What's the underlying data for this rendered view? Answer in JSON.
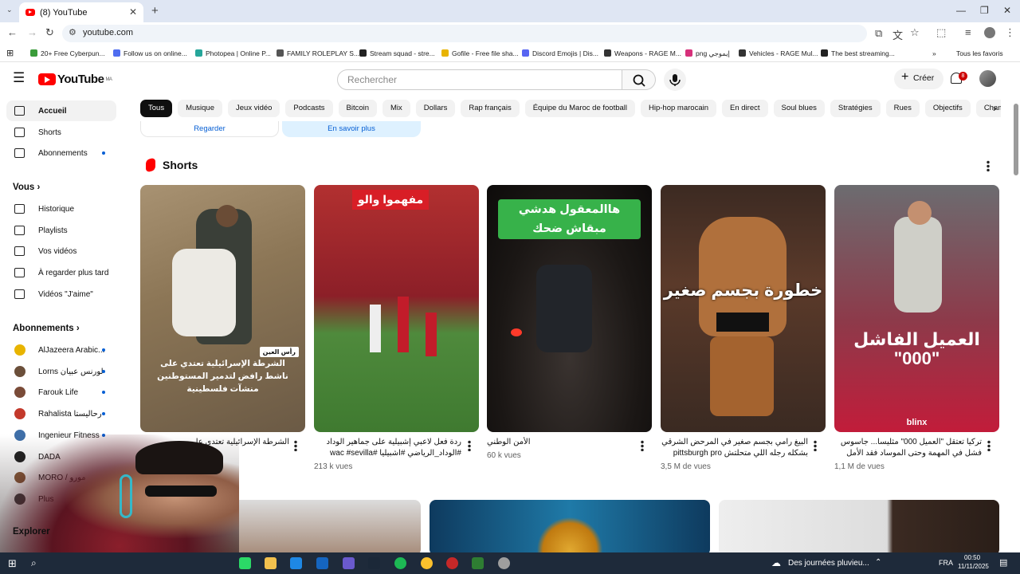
{
  "browser": {
    "tab_title": "(8) YouTube",
    "new_tab": "+",
    "url": "youtube.com",
    "bookmarks": [
      {
        "label": "20+ Free Cyberpun...",
        "color": "#3a9c3a"
      },
      {
        "label": "Follow us on online...",
        "color": "#4f6df0"
      },
      {
        "label": "Photopea | Online P...",
        "color": "#26a69a"
      },
      {
        "label": "FAMILY ROLEPLAY S...",
        "color": "#555555"
      },
      {
        "label": "Stream squad - stre...",
        "color": "#222222"
      },
      {
        "label": "Gofile - Free file sha...",
        "color": "#e8b400"
      },
      {
        "label": "Discord Emojis | Dis...",
        "color": "#5865f2"
      },
      {
        "label": "Weapons - RAGE M...",
        "color": "#333333"
      },
      {
        "label": "png إيموجي",
        "color": "#d6307a"
      },
      {
        "label": "Vehicles - RAGE Mul...",
        "color": "#333333"
      },
      {
        "label": "The best streaming...",
        "color": "#222222"
      }
    ],
    "all_bookmarks": "Tous les favoris"
  },
  "youtube": {
    "logo": "YouTube",
    "region": "MA",
    "search_placeholder": "Rechercher",
    "create": "Créer",
    "notifications": "8",
    "sidebar": {
      "main": [
        "Accueil",
        "Shorts",
        "Abonnements"
      ],
      "you_header": "Vous",
      "you": [
        "Historique",
        "Playlists",
        "Vos vidéos",
        "À regarder plus tard",
        "Vidéos \"J'aime\""
      ],
      "subs_header": "Abonnements",
      "subs": [
        "AlJazeera Arabic...",
        "Lorns لورنس عبيان",
        "Farouk Life",
        "Rahalista رحاليستا",
        "Ingenieur Fitness",
        "DADA",
        "MORO / مورو",
        "Plus"
      ],
      "explore_header": "Explorer"
    },
    "chips": [
      "Tous",
      "Musique",
      "Jeux vidéo",
      "Podcasts",
      "Bitcoin",
      "Mix",
      "Dollars",
      "Rap français",
      "Équipe du Maroc de football",
      "Hip-hop marocain",
      "En direct",
      "Soul blues",
      "Stratégies",
      "Rues",
      "Objectifs",
      "Championnats"
    ],
    "cta": {
      "watch": "Regarder",
      "learn": "En savoir plus"
    },
    "shorts_title": "Shorts",
    "shorts": [
      {
        "title": "الشرطة الإسرائيلية تعتدي على",
        "views": "",
        "overlay": "الشرطة الإسرائيلية تعتدي على ناشط رافض لتدمير المستوطنين منشآت فلسطينية",
        "tag": "رأس العين"
      },
      {
        "title": "ردة فعل لاعبي إشبيلية على جماهير الوداد #الوداد_الرياضي #اشبيليا #wac #sevilla",
        "views": "213 k vues",
        "overlay": "مفهموا والو"
      },
      {
        "title": "الأمن الوطني",
        "views": "60 k vues",
        "overlay": "هاالمعقول هدشي مبقاش ضحك"
      },
      {
        "title": "البيغ رامي بجسم صغير في المرحض الشرقي بشكله رجله اللي متحلتش pittsburgh pro بطولة",
        "views": "3,5 M de vues",
        "overlay": "خطورة بجسم صغير"
      },
      {
        "title": "تركيا تعتقل \"العميل 000\" مثليسا... جاسوس فشل في المهمة وحتى الموساد فقد الأمل فيه. ما قصته؟",
        "views": "1,1 M de vues",
        "overlay": "العميل الفاشل \"000\"",
        "brand": "blinx"
      }
    ]
  },
  "taskbar": {
    "weather": "Des journées pluvieu...",
    "lang": "FRA",
    "time": "00:50",
    "date": "11/11/2025"
  }
}
